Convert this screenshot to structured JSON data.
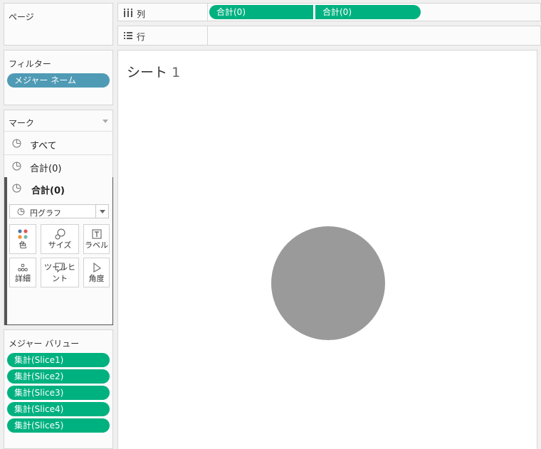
{
  "pages": {
    "title": "ページ"
  },
  "filters": {
    "title": "フィルター",
    "pills": [
      {
        "label": "メジャー ネーム",
        "color": "#4f9bb5"
      }
    ]
  },
  "marks": {
    "title": "マーク",
    "rows": [
      {
        "label": "すべて",
        "icon": "pie-chart-icon"
      },
      {
        "label": "合計(0)",
        "icon": "pie-chart-icon"
      }
    ],
    "active": {
      "label": "合計(0)",
      "mark_type": "円グラフ",
      "buttons": [
        {
          "label": "色",
          "icon": "color-dots-icon"
        },
        {
          "label": "サイズ",
          "icon": "size-icon"
        },
        {
          "label": "ラベル",
          "icon": "label-icon"
        },
        {
          "label": "詳細",
          "icon": "detail-icon"
        },
        {
          "label": "ツールヒント",
          "icon": "tooltip-icon"
        },
        {
          "label": "角度",
          "icon": "angle-icon"
        }
      ]
    }
  },
  "measure_values": {
    "title": "メジャー バリュー",
    "pills": [
      {
        "label": "集計(Slice1)"
      },
      {
        "label": "集計(Slice2)"
      },
      {
        "label": "集計(Slice3)"
      },
      {
        "label": "集計(Slice4)"
      },
      {
        "label": "集計(Slice5)"
      }
    ]
  },
  "shelves": {
    "columns": {
      "label": "列",
      "icon": "columns-icon",
      "pills": [
        {
          "label": "合計(0)"
        },
        {
          "label": "合計(0)"
        }
      ]
    },
    "rows": {
      "label": "行",
      "icon": "rows-icon",
      "pills": []
    }
  },
  "sheet": {
    "title": "シート",
    "number": "1"
  },
  "colors": {
    "accent_green": "#00b180",
    "filter_blue": "#4f9bb5",
    "pie_gray": "#9a9a9a"
  }
}
